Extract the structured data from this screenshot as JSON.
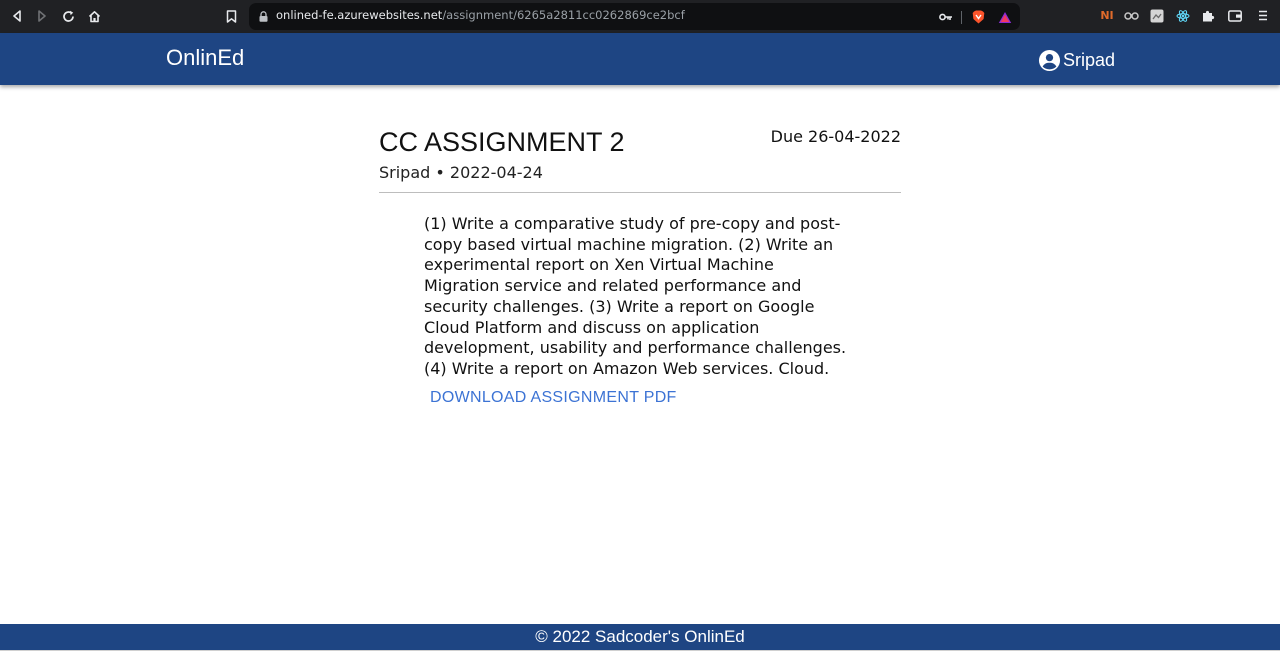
{
  "browser": {
    "url_host": "onlined-fe.azurewebsites.net",
    "url_path": "/assignment/6265a2811cc0262869ce2bcf",
    "nav_icons": [
      "back-icon",
      "forward-icon",
      "reload-icon",
      "home-icon",
      "bookmark-icon"
    ],
    "url_icons": [
      "key-icon",
      "brave-shield-icon",
      "brave-rewards-icon"
    ],
    "extension_icons": [
      "ni-extension-icon",
      "glasses-extension-icon",
      "square-extension-icon",
      "react-devtools-icon",
      "puzzle-extensions-icon",
      "wallet-icon",
      "menu-icon"
    ],
    "ni_label": "NI"
  },
  "header": {
    "brand": "OnlinEd",
    "user_name": "Sripad",
    "bg_color": "#1e4583"
  },
  "assignment": {
    "title": "CC ASSIGNMENT 2",
    "due": "Due 26-04-2022",
    "meta": "Sripad • 2022-04-24",
    "description": "(1) Write a comparative study of pre-copy and post-copy based virtual machine migration. (2) Write an experimental report on Xen Virtual Machine Migration service and related performance and security challenges. (3) Write a report on Google Cloud Platform and discuss on application development, usability and performance challenges. (4) Write a report on Amazon Web services. Cloud.",
    "download_label": "DOWNLOAD ASSIGNMENT PDF",
    "link_color": "#3c73d4"
  },
  "footer": {
    "text": "© 2022 Sadcoder's OnlinEd"
  }
}
